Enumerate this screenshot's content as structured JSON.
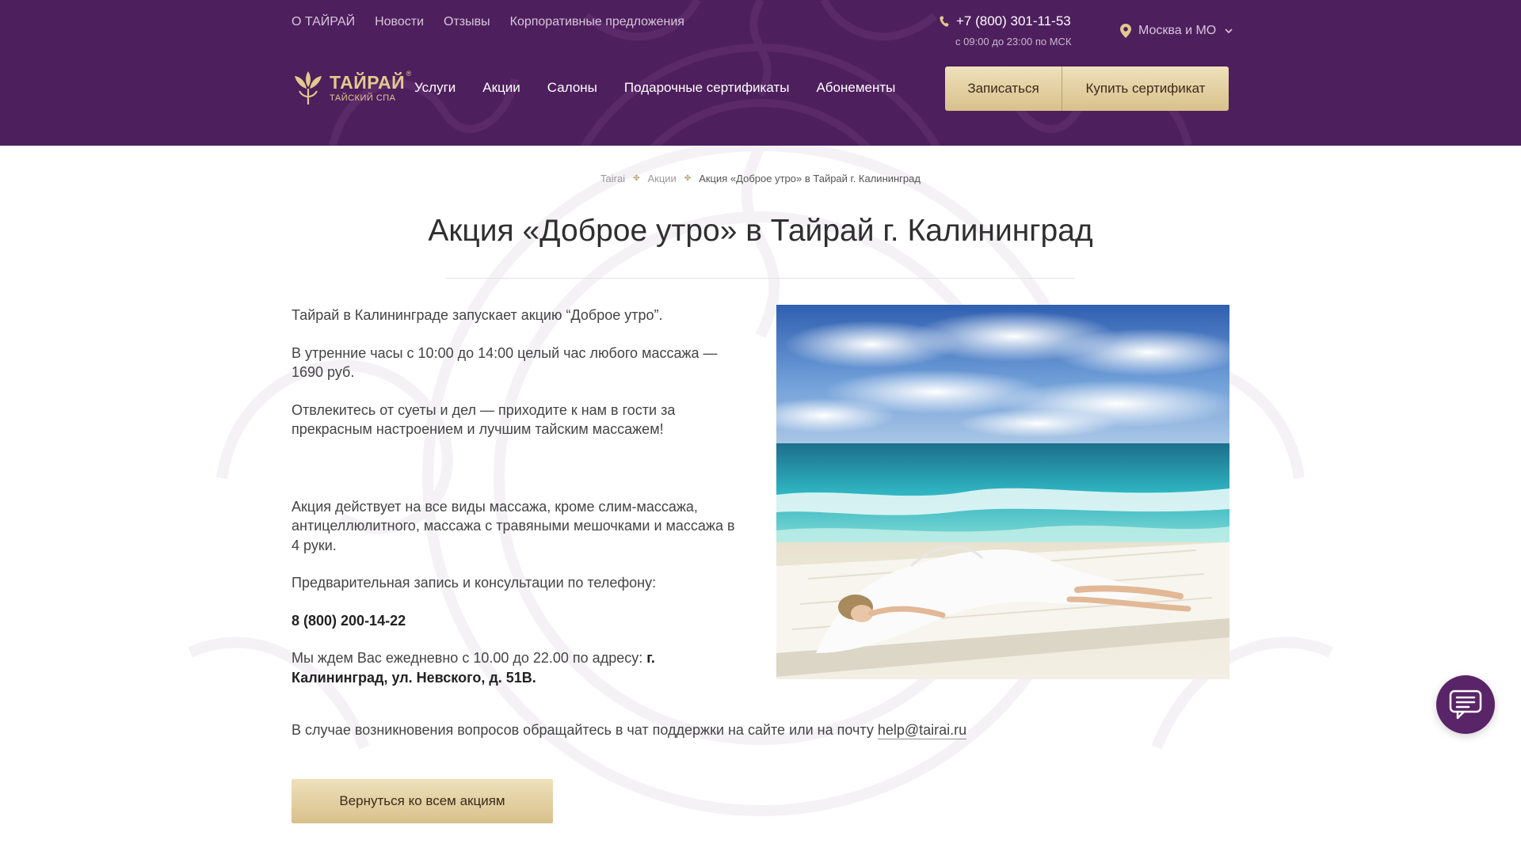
{
  "header": {
    "top_links": [
      "О ТАЙРАЙ",
      "Новости",
      "Отзывы",
      "Корпоративные предложения"
    ],
    "phone": "+7 (800) 301-11-53",
    "phone_hours": "с 09:00 до 23:00 по МСК",
    "city": "Москва и МО",
    "logo_name": "ТАЙРАЙ",
    "logo_sub": "ТАЙСКИЙ СПА",
    "logo_reg": "®",
    "nav": [
      "Услуги",
      "Акции",
      "Салоны",
      "Подарочные сертификаты",
      "Абонементы"
    ],
    "signup_label": "Записаться",
    "buy_cert_label": "Купить сертификат"
  },
  "breadcrumb": {
    "items": [
      "Tairai",
      "Акции"
    ],
    "current": "Акция «Доброе утро» в Тайрай г. Калининград",
    "separator": "✤"
  },
  "page": {
    "title": "Акция «Доброе утро» в Тайрай г. Калининград",
    "p1": "Тайрай в Калининграде запускает акцию “Доброе утро”.",
    "p2": "В утренние часы с 10:00 до 14:00 целый час любого массажа — 1690 руб.",
    "p3": "Отвлекитесь от суеты и дел — приходите к нам в гости за прекрасным настроением и лучшим тайским массажем!",
    "p4": "Акция действует на все виды массажа, кроме слим-массажа, антицеллюлитного, массажа с травяными мешочками и массажа в 4 руки.",
    "p5": "Предварительная запись и консультации по телефону:",
    "booking_phone": "8 (800) 200-14-22",
    "p6_prefix": "Мы ждем Вас ежедневно с 10.00 до 22.00 по адресу:",
    "address": "г. Калининград, ул. Невского, д. 51В.",
    "contact_prefix": "В случае возникновения вопросов обращайтесь в чат поддержки на сайте или на почту",
    "email": "help@tairai.ru",
    "back_label": "Вернуться ко всем акциям"
  },
  "icons": {
    "phone": "phone-icon",
    "city_pin": "location-pin-icon",
    "city_dropdown": "chevron-down-icon",
    "chat": "chat-bubble-icon"
  },
  "colors": {
    "header_bg": "#4e1f5d",
    "gold": "#e2c98d",
    "button_gold_top": "#efe1bb",
    "button_gold_bottom": "#d8c08b",
    "chat_button": "#5a2468"
  }
}
